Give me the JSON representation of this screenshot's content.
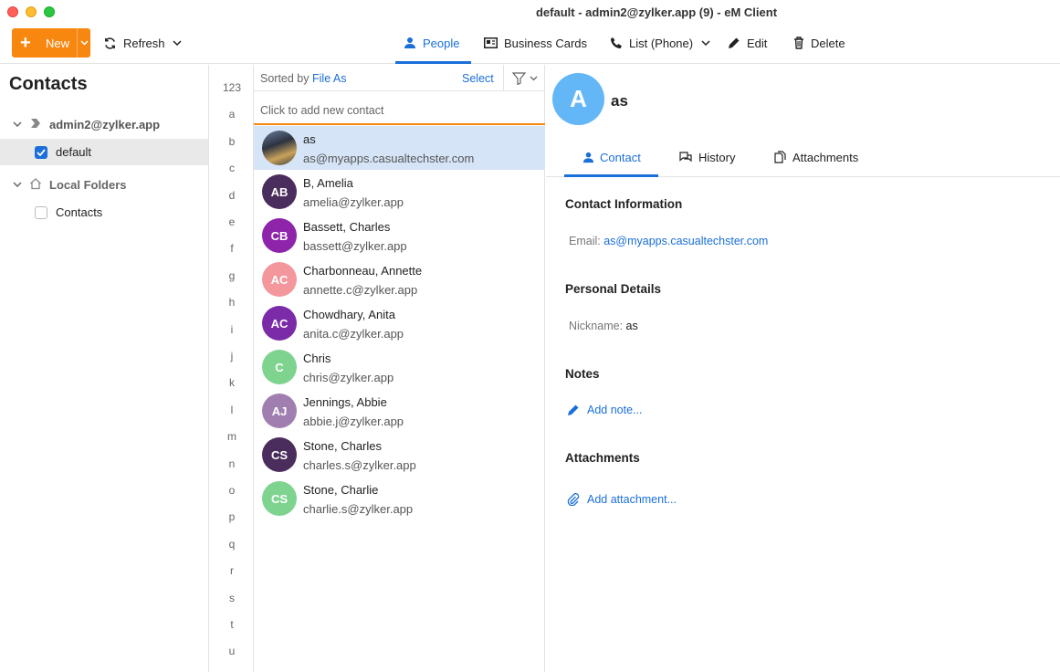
{
  "window": {
    "title": "default - admin2@zylker.app (9) - eM Client"
  },
  "toolbar": {
    "new_label": "New",
    "refresh_label": "Refresh",
    "people_label": "People",
    "business_cards_label": "Business Cards",
    "list_phone_label": "List (Phone)",
    "edit_label": "Edit",
    "delete_label": "Delete"
  },
  "sidebar": {
    "title": "Contacts",
    "account": "admin2@zylker.app",
    "default_folder": "default",
    "local_folders": "Local Folders",
    "contacts_folder": "Contacts"
  },
  "letters": [
    "123",
    "a",
    "b",
    "c",
    "d",
    "e",
    "f",
    "g",
    "h",
    "i",
    "j",
    "k",
    "l",
    "m",
    "n",
    "o",
    "p",
    "q",
    "r",
    "s",
    "t",
    "u"
  ],
  "list": {
    "sorted_prefix": "Sorted by",
    "sorted_field": "File As",
    "select_label": "Select",
    "add_placeholder": "Click to add new contact",
    "contacts": [
      {
        "name": "as",
        "email": "as@myapps.casualtechster.com",
        "initials": "",
        "color": "#3a3a3a",
        "photo": true
      },
      {
        "name": "B, Amelia",
        "email": "amelia@zylker.app",
        "initials": "AB",
        "color": "#4a2d5c"
      },
      {
        "name": "Bassett, Charles",
        "email": "bassett@zylker.app",
        "initials": "CB",
        "color": "#8e24aa"
      },
      {
        "name": "Charbonneau, Annette",
        "email": "annette.c@zylker.app",
        "initials": "AC",
        "color": "#f4979c"
      },
      {
        "name": "Chowdhary, Anita",
        "email": "anita.c@zylker.app",
        "initials": "AC",
        "color": "#7b2aa8"
      },
      {
        "name": "Chris",
        "email": "chris@zylker.app",
        "initials": "C",
        "color": "#7ed38f"
      },
      {
        "name": "Jennings, Abbie",
        "email": "abbie.j@zylker.app",
        "initials": "AJ",
        "color": "#a07fb0"
      },
      {
        "name": "Stone, Charles",
        "email": "charles.s@zylker.app",
        "initials": "CS",
        "color": "#4a2d5c"
      },
      {
        "name": "Stone, Charlie",
        "email": "charlie.s@zylker.app",
        "initials": "CS",
        "color": "#7ed38f"
      }
    ]
  },
  "detail": {
    "avatar_initial": "A",
    "name": "as",
    "tabs": {
      "contact": "Contact",
      "history": "History",
      "attachments": "Attachments"
    },
    "contact_info_title": "Contact Information",
    "email_label": "Email:",
    "email_value": "as@myapps.casualtechster.com",
    "personal_title": "Personal Details",
    "nickname_label": "Nickname:",
    "nickname_value": "as",
    "notes_title": "Notes",
    "add_note": "Add note...",
    "attachments_title": "Attachments",
    "add_attachment": "Add attachment..."
  },
  "colors": {
    "accent": "#1a6fd9",
    "new_button": "#f7870f",
    "selected_row": "#d6e4f7"
  }
}
